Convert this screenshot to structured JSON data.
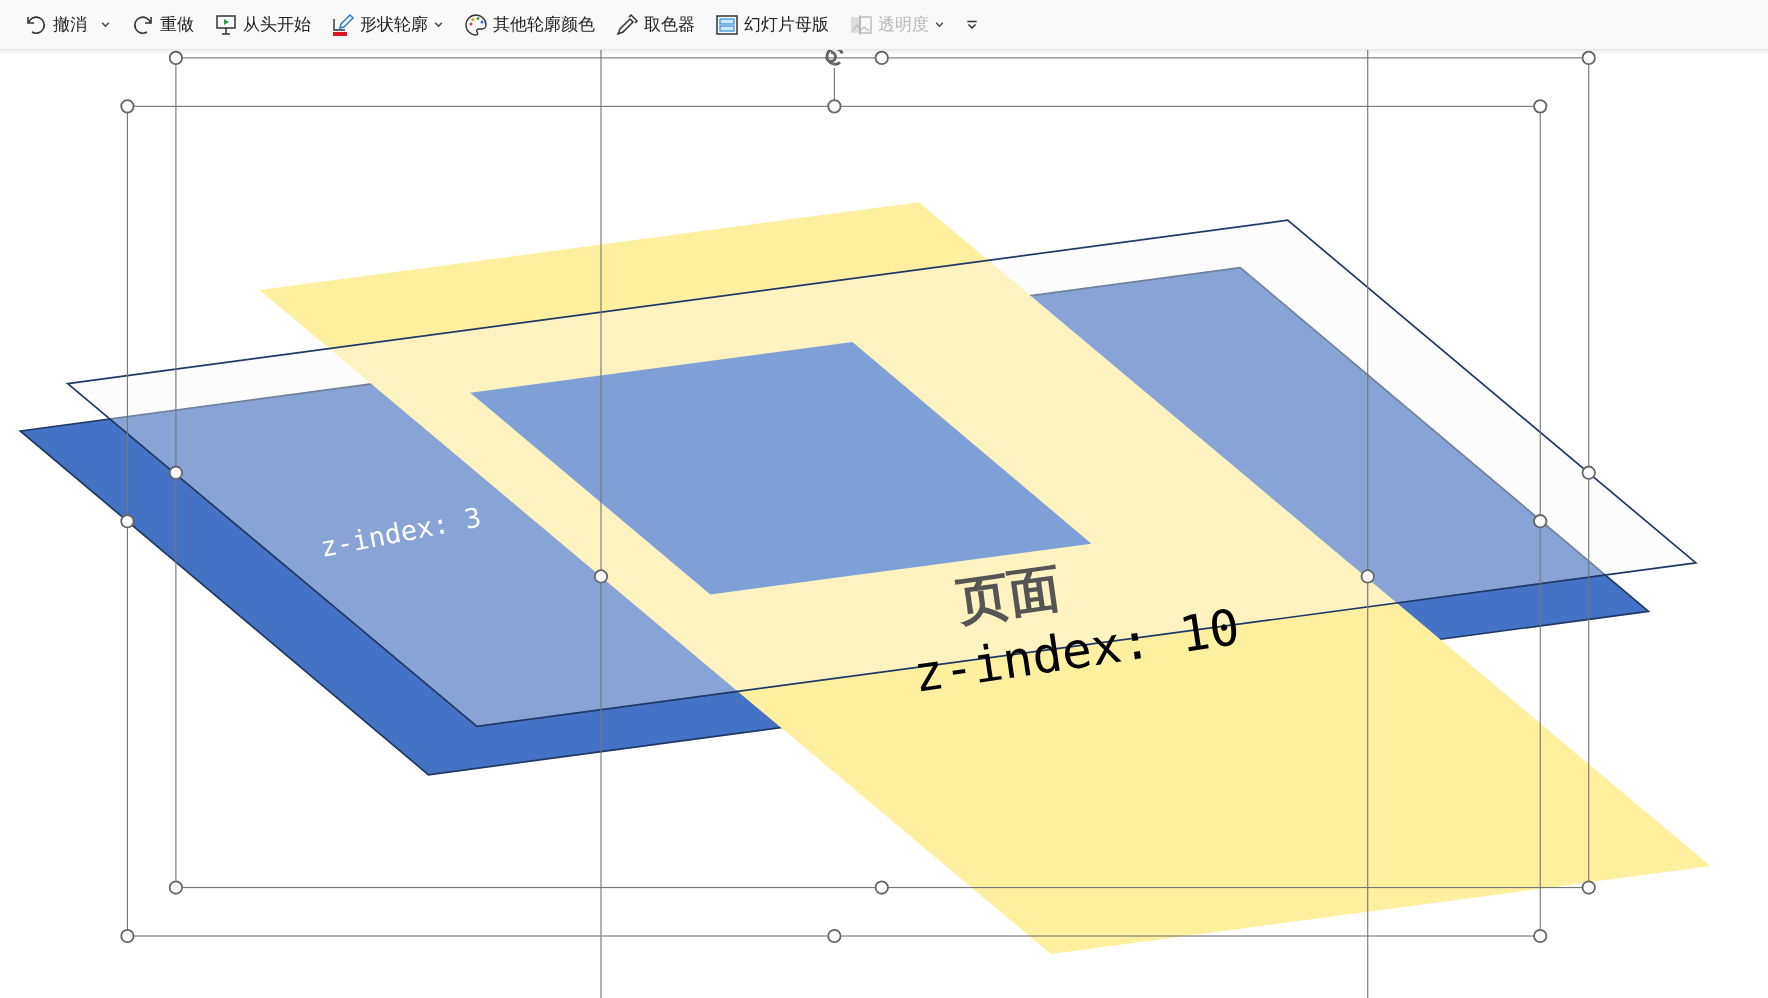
{
  "toolbar": [
    {
      "label": "撤消",
      "dropdown": true,
      "disabled": false
    },
    {
      "label": "重做",
      "dropdown": false,
      "disabled": false
    },
    {
      "label": "从头开始",
      "dropdown": false,
      "disabled": false
    },
    {
      "label": "形状轮廓",
      "dropdown": true,
      "disabled": false
    },
    {
      "label": "其他轮廓颜色",
      "dropdown": false,
      "disabled": false
    },
    {
      "label": "取色器",
      "dropdown": false,
      "disabled": false
    },
    {
      "label": "幻灯片母版",
      "dropdown": false,
      "disabled": false
    },
    {
      "label": "透明度",
      "dropdown": true,
      "disabled": true
    }
  ],
  "canvas": {
    "labels": [
      {
        "kind": "layer",
        "text": "z-index: 3"
      },
      {
        "kind": "title",
        "text": "页面"
      },
      {
        "kind": "main",
        "text": "z-index: 10"
      }
    ]
  }
}
